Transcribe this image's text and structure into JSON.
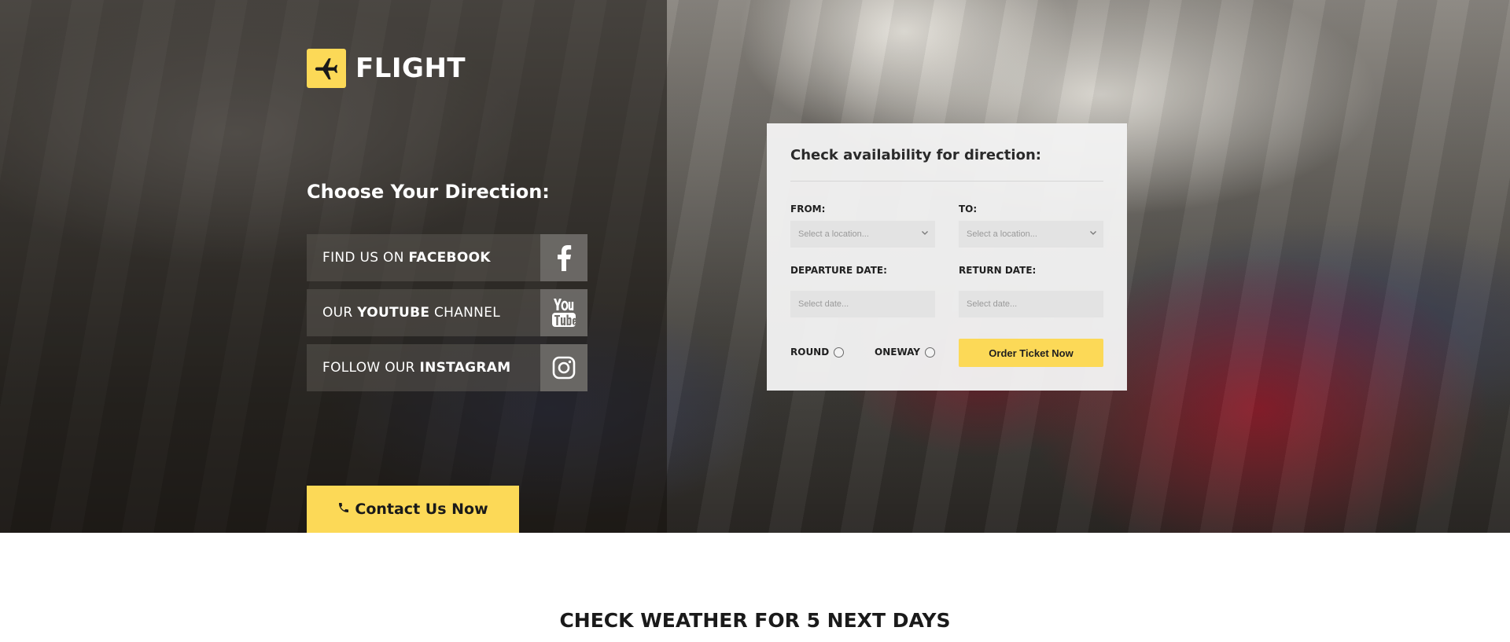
{
  "brand": {
    "name": "FLIGHT",
    "icon": "plane-icon",
    "accent": "#fcd957"
  },
  "hero": {
    "direction_title": "Choose Your Direction:",
    "social": [
      {
        "prefix": "FIND US ON ",
        "bold": "FACEBOOK",
        "suffix": "",
        "icon": "facebook-icon"
      },
      {
        "prefix": "OUR ",
        "bold": "YOUTUBE",
        "suffix": " CHANNEL",
        "icon": "youtube-icon"
      },
      {
        "prefix": "FOLLOW OUR ",
        "bold": "INSTAGRAM",
        "suffix": "",
        "icon": "instagram-icon"
      }
    ],
    "contact_label": "Contact Us Now",
    "contact_icon": "phone-icon"
  },
  "form": {
    "title": "Check availability for direction:",
    "from_label": "FROM:",
    "to_label": "TO:",
    "from_placeholder": "Select a location...",
    "to_placeholder": "Select a location...",
    "departure_label": "DEPARTURE DATE:",
    "return_label": "RETURN DATE:",
    "departure_placeholder": "Select date...",
    "return_placeholder": "Select date...",
    "round_label": "ROUND",
    "oneway_label": "ONEWAY",
    "order_label": "Order Ticket Now"
  },
  "weather": {
    "title": "CHECK WEATHER FOR 5 NEXT DAYS"
  }
}
